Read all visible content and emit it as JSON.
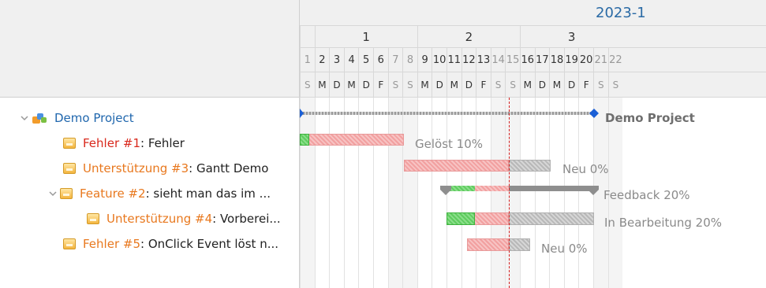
{
  "header": {
    "period": "2023-1",
    "weeks": [
      "1",
      "2",
      "3"
    ],
    "days": [
      "1",
      "2",
      "3",
      "4",
      "5",
      "6",
      "7",
      "8",
      "9",
      "10",
      "11",
      "12",
      "13",
      "14",
      "15",
      "16",
      "17",
      "18",
      "19",
      "20",
      "21",
      "22"
    ],
    "weekdays": [
      "S",
      "M",
      "D",
      "M",
      "D",
      "F",
      "S",
      "S",
      "M",
      "D",
      "M",
      "D",
      "F",
      "S",
      "S",
      "M",
      "D",
      "M",
      "D",
      "F",
      "S",
      "S"
    ]
  },
  "rows": [
    {
      "link": "Demo Project",
      "rest": "",
      "status": "Demo Project"
    },
    {
      "link": "Fehler #1",
      "rest": ": Fehler",
      "status": "Gelöst 10%"
    },
    {
      "link": "Unterstützung #3",
      "rest": ": Gantt Demo",
      "status": "Neu 0%"
    },
    {
      "link": "Feature #2",
      "rest": ": sieht man das im ...",
      "status": "Feedback 20%"
    },
    {
      "link": "Unterstützung #4",
      "rest": ": Vorberei...",
      "status": "In Bearbeitung 20%"
    },
    {
      "link": "Fehler #5",
      "rest": ": OnClick Event löst n...",
      "status": "Neu 0%"
    }
  ],
  "colors": {
    "project_marker": "#1a5fd6",
    "today_line": "#d42020",
    "progress": "#4cbf4c",
    "late": "#f2a0a0",
    "pending": "#c8c8c8"
  }
}
